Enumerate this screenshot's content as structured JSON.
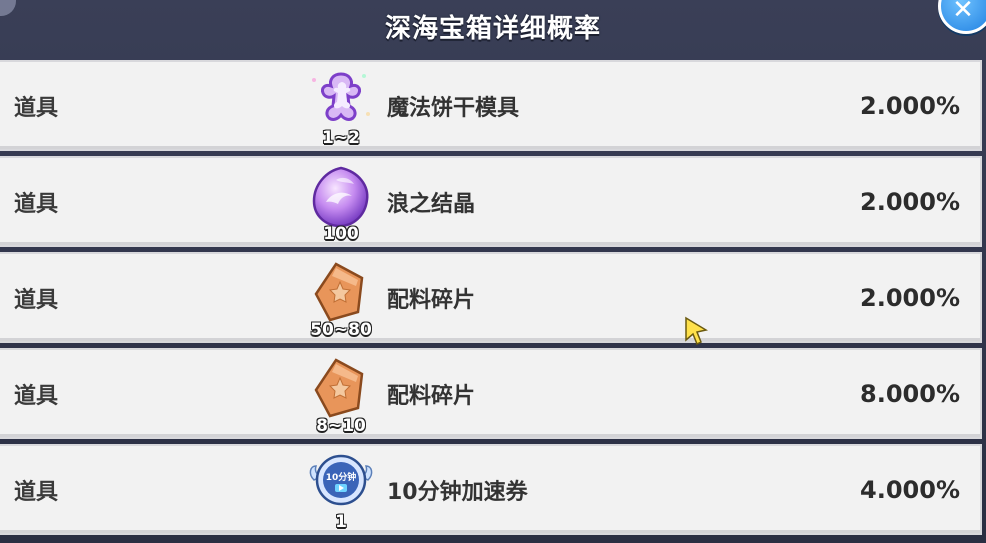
{
  "header": {
    "title": "深海宝箱详细概率"
  },
  "rows": [
    {
      "type": "道具",
      "icon": "magic-cookie-cutter-icon",
      "qty": "1~2",
      "name": "魔法饼干模具",
      "rate": "2.000%"
    },
    {
      "type": "道具",
      "icon": "wave-crystal-icon",
      "qty": "100",
      "name": "浪之结晶",
      "rate": "2.000%"
    },
    {
      "type": "道具",
      "icon": "ingredient-shard-icon",
      "qty": "50~80",
      "name": "配料碎片",
      "rate": "2.000%"
    },
    {
      "type": "道具",
      "icon": "ingredient-shard-icon",
      "qty": "8~10",
      "name": "配料碎片",
      "rate": "8.000%"
    },
    {
      "type": "道具",
      "icon": "speedup-ticket-icon",
      "qty": "1",
      "name": "10分钟加速券",
      "rate": "4.000%",
      "icon_text": "10分钟"
    }
  ],
  "colors": {
    "header_bg": "#2a2e42",
    "row_bg": "#f2f2f2",
    "close_button": "#1f7fe0",
    "shard_orange": "#e08a4a",
    "crystal_purple": "#b77be8"
  }
}
